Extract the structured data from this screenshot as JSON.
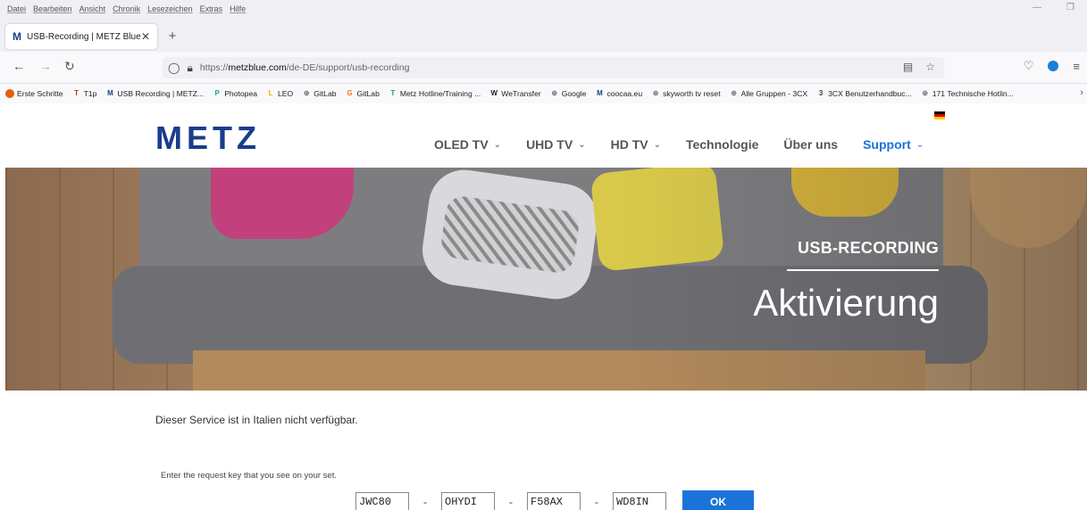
{
  "menubar": [
    "Datei",
    "Bearbeiten",
    "Ansicht",
    "Chronik",
    "Lesezeichen",
    "Extras",
    "Hilfe"
  ],
  "tab": {
    "favicon": "M",
    "title": "USB-Recording | METZ Blue",
    "close": "✕",
    "new": "+"
  },
  "nav": {
    "back": "←",
    "forward": "→",
    "reload": "↻",
    "url_prefix": "https://",
    "url_host": "metzblue.com",
    "url_path": "/de-DE/support/usb-recording"
  },
  "bookmarks": [
    {
      "icon": "firefox-icon",
      "label": "Erste Schritte",
      "color": "#e66000"
    },
    {
      "icon": "tip-icon",
      "label": "T1p",
      "color": "#c0392b",
      "glyph": "T"
    },
    {
      "icon": "metz-icon",
      "label": "USB Recording | METZ...",
      "color": "#1a3c8c",
      "glyph": "M"
    },
    {
      "icon": "photopea-icon",
      "label": "Photopea",
      "color": "#18a497",
      "glyph": "P"
    },
    {
      "icon": "leo-icon",
      "label": "LEO",
      "color": "#e6b800",
      "glyph": "L"
    },
    {
      "icon": "globe-icon",
      "label": "GitLab",
      "color": "#777777",
      "glyph": "⊕"
    },
    {
      "icon": "gitlab-icon",
      "label": "GitLab",
      "color": "#fc6d26",
      "glyph": "G"
    },
    {
      "icon": "metz-hotline-icon",
      "label": "Metz Hotline/Training ...",
      "color": "#2e9e44",
      "glyph": "T"
    },
    {
      "icon": "wetransfer-icon",
      "label": "WeTransfer",
      "color": "#222222",
      "glyph": "W"
    },
    {
      "icon": "globe-icon",
      "label": "Google",
      "color": "#777777",
      "glyph": "⊕"
    },
    {
      "icon": "metz-icon",
      "label": "coocaa.eu",
      "color": "#1a3c8c",
      "glyph": "M"
    },
    {
      "icon": "globe-icon",
      "label": "skyworth tv reset",
      "color": "#777777",
      "glyph": "⊕"
    },
    {
      "icon": "globe-icon",
      "label": "Alle Gruppen - 3CX",
      "color": "#777777",
      "glyph": "⊕"
    },
    {
      "icon": "3cx-icon",
      "label": "3CX Benutzerhandbuc...",
      "color": "#444444",
      "glyph": "3"
    },
    {
      "icon": "globe-icon",
      "label": "171 Technische Hotlin...",
      "color": "#777777",
      "glyph": "⊕"
    }
  ],
  "site": {
    "logo": "METZ",
    "nav": [
      {
        "label": "OLED TV",
        "chevron": "⌄",
        "active": false
      },
      {
        "label": "UHD TV",
        "chevron": "⌄",
        "active": false
      },
      {
        "label": "HD TV",
        "chevron": "⌄",
        "active": false
      },
      {
        "label": "Technologie",
        "chevron": "",
        "active": false
      },
      {
        "label": "Über uns",
        "chevron": "",
        "active": false
      },
      {
        "label": "Support",
        "chevron": "⌄",
        "active": true
      }
    ],
    "accent_color": "#1a73d9",
    "brand_color": "#1a3c8c"
  },
  "hero": {
    "kicker": "USB-RECORDING",
    "title": "Aktivierung"
  },
  "notice": "Dieser Service ist in Italien nicht verfügbar.",
  "request": {
    "label": "Enter the request key that you see on your set.",
    "keys": [
      "JWC80",
      "OHYDI",
      "F58AX",
      "WD8IN"
    ],
    "separator": "-",
    "ok_label": "OK"
  }
}
